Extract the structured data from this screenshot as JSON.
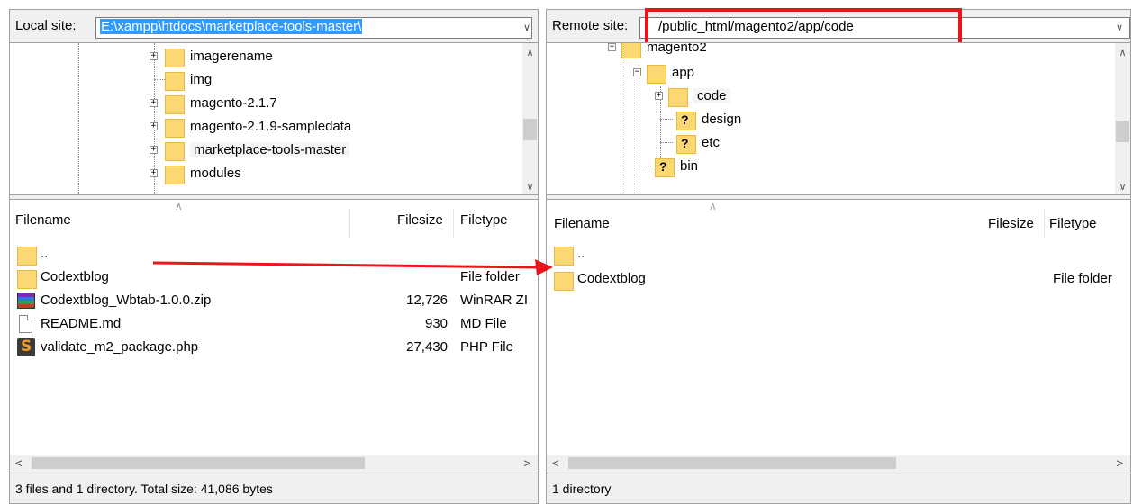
{
  "local": {
    "site_label": "Local site:",
    "path": "E:\\xampp\\htdocs\\marketplace-tools-master\\",
    "tree": [
      {
        "label": "imagerename",
        "expandable": true
      },
      {
        "label": "img",
        "expandable": false
      },
      {
        "label": "magento-2.1.7",
        "expandable": true
      },
      {
        "label": "magento-2.1.9-sampledata",
        "expandable": true
      },
      {
        "label": "marketplace-tools-master",
        "expandable": true,
        "selected": true
      },
      {
        "label": "modules",
        "expandable": true
      }
    ],
    "columns": {
      "filename": "Filename",
      "filesize": "Filesize",
      "filetype": "Filetype"
    },
    "files": [
      {
        "name": "..",
        "size": "",
        "type": "",
        "icon": "folder-icon"
      },
      {
        "name": "Codextblog",
        "size": "",
        "type": "File folder",
        "icon": "folder-icon"
      },
      {
        "name": "Codextblog_Wbtab-1.0.0.zip",
        "size": "12,726",
        "type": "WinRAR ZI",
        "icon": "winrar-archive-icon"
      },
      {
        "name": "README.md",
        "size": "930",
        "type": "MD File",
        "icon": "document-icon"
      },
      {
        "name": "validate_m2_package.php",
        "size": "27,430",
        "type": "PHP File",
        "icon": "php-file-icon"
      }
    ],
    "status": "3 files and 1 directory. Total size: 41,086 bytes"
  },
  "remote": {
    "site_label": "Remote site:",
    "path": "/public_html/magento2/app/code",
    "tree": [
      {
        "label": "magento2",
        "expandable": true,
        "expanded": true
      },
      {
        "label": "app",
        "expandable": true,
        "expanded": true
      },
      {
        "label": "code",
        "expandable": true,
        "selected": true
      },
      {
        "label": "design",
        "unknown": true
      },
      {
        "label": "etc",
        "unknown": true
      },
      {
        "label": "bin",
        "unknown": true
      }
    ],
    "columns": {
      "filename": "Filename",
      "filesize": "Filesize",
      "filetype": "Filetype"
    },
    "files": [
      {
        "name": "..",
        "size": "",
        "type": "",
        "icon": "folder-icon"
      },
      {
        "name": "Codextblog",
        "size": "",
        "type": "File folder",
        "icon": "folder-icon"
      }
    ],
    "status": "1 directory"
  },
  "colors": {
    "annotation_red": "#e8161b",
    "selection_blue": "#3399ff",
    "folder_yellow": "#fcd873"
  }
}
